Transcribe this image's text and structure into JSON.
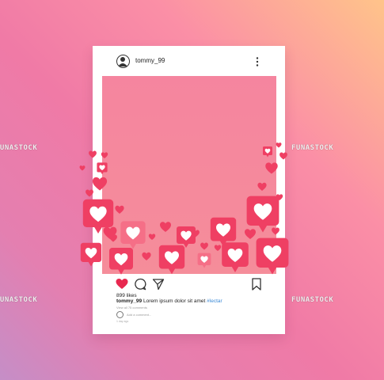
{
  "post": {
    "username": "tommy_99",
    "likes": "899 likes",
    "caption_user": "tommy_99",
    "caption_text": " Lorem ipsum dolor sit amet ",
    "caption_hashtag": "#lectar",
    "view_comments": "View all 75 comments",
    "comment_placeholder": "Add a comment...",
    "time_ago": "1 day ago"
  },
  "watermark": "FUNASTOCK",
  "colors": {
    "heart_bubble": "#ef3f63",
    "heart_bubble_light": "#f56f87",
    "like_active": "#e8284f",
    "hashtag": "#3c8ad6",
    "photo": "#f5859f"
  },
  "icons": [
    "user-avatar-icon",
    "more-options-icon",
    "heart-icon",
    "comment-icon",
    "share-icon",
    "bookmark-icon"
  ]
}
